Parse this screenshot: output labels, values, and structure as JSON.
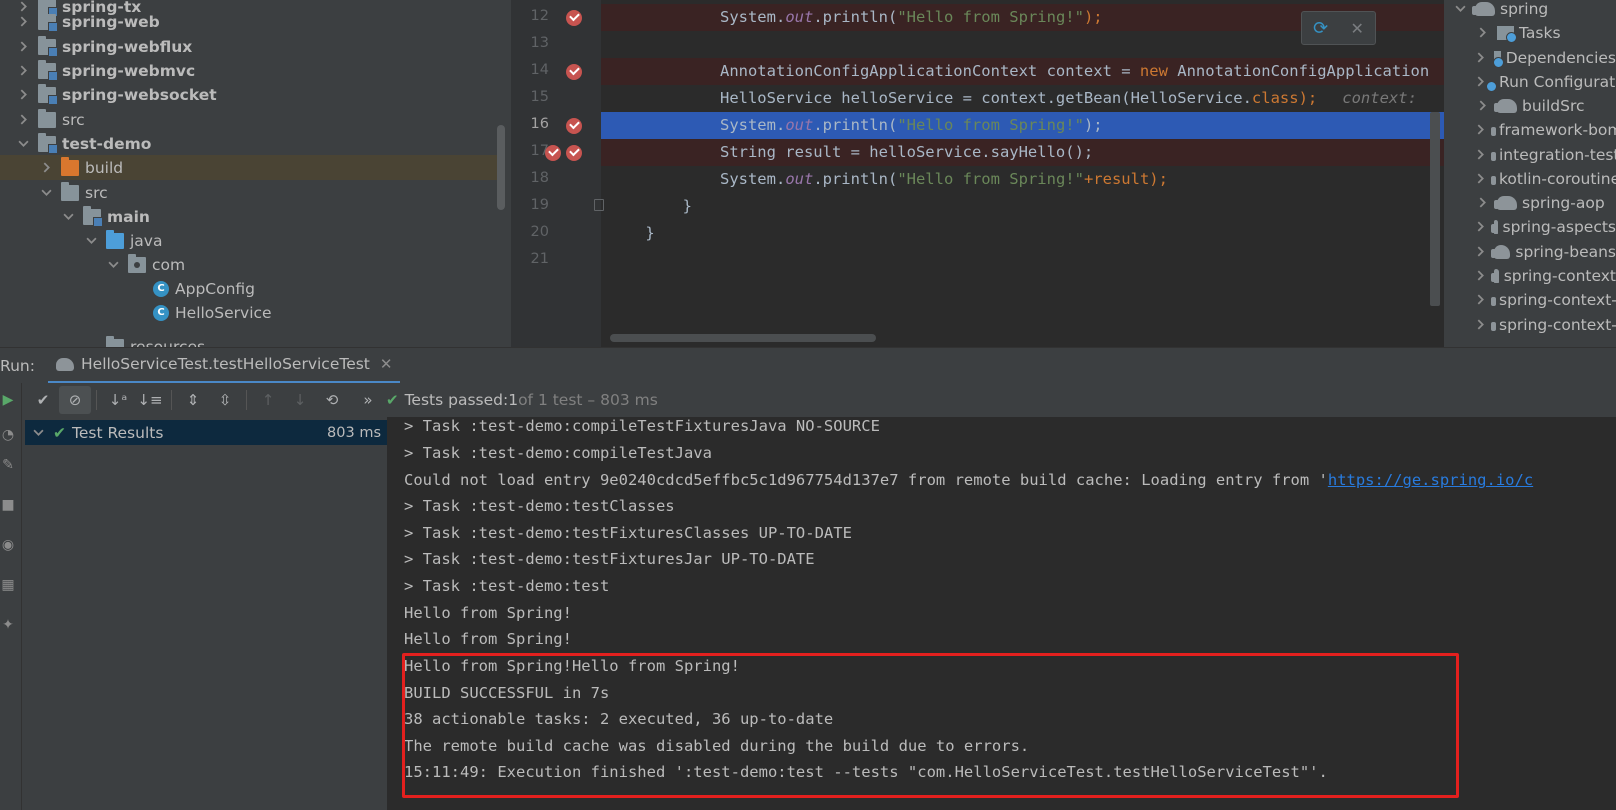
{
  "project_tree": {
    "items": [
      {
        "label": "spring-tx",
        "icon": "module-folder-icon"
      },
      {
        "label": "spring-web",
        "icon": "module-folder-icon"
      },
      {
        "label": "spring-webflux",
        "icon": "module-folder-icon"
      },
      {
        "label": "spring-webmvc",
        "icon": "module-folder-icon"
      },
      {
        "label": "spring-websocket",
        "icon": "module-folder-icon"
      },
      {
        "label": "src",
        "icon": "folder-icon"
      },
      {
        "label": "test-demo",
        "icon": "module-folder-icon"
      },
      {
        "label": "build",
        "icon": "build-folder-icon"
      },
      {
        "label": "src",
        "icon": "folder-icon"
      },
      {
        "label": "main",
        "icon": "source-folder-icon"
      },
      {
        "label": "java",
        "icon": "source-folder-icon"
      },
      {
        "label": "com",
        "icon": "package-icon"
      },
      {
        "label": "AppConfig",
        "icon": "class-icon"
      },
      {
        "label": "HelloService",
        "icon": "class-icon"
      },
      {
        "label": "resources",
        "icon": "folder-icon"
      }
    ]
  },
  "editor": {
    "line_numbers": [
      "12",
      "13",
      "14",
      "15",
      "16",
      "17",
      "18",
      "19",
      "20",
      "21"
    ],
    "current_line": "16",
    "code": {
      "l12": {
        "indent": "            ",
        "a": "System.",
        "b": "out",
        "c": ".println(",
        "d": "\"Hello from Spring!\"",
        "e": ");"
      },
      "l14": {
        "indent": "            ",
        "a": "AnnotationConfigApplicationContext context = ",
        "kw": "new",
        "b": " AnnotationConfigApplication"
      },
      "l15": {
        "indent": "            ",
        "a": "HelloService helloService = context.getBean(HelloService.",
        "kw": "class",
        "b": ");",
        "hint": "context: "
      },
      "l16": {
        "indent": "            ",
        "a": "System.",
        "b": "out",
        "c": ".println(",
        "d": "\"Hello from Spring!\"",
        "e": ");"
      },
      "l17": {
        "indent": "            ",
        "a": "String result = helloService.sayHello();"
      },
      "l18": {
        "indent": "            ",
        "a": "System.",
        "b": "out",
        "c": ".println(",
        "d": "\"Hello from Spring!\"",
        "e": "+result);"
      },
      "l19": {
        "indent": "        ",
        "a": "}"
      },
      "l20": {
        "indent": "    ",
        "a": "}"
      }
    }
  },
  "gradle_panel": {
    "root": "spring",
    "items": [
      {
        "label": "Tasks",
        "icon": "tasks-folder-icon"
      },
      {
        "label": "Dependencies",
        "icon": "dependencies-icon"
      },
      {
        "label": "Run Configurations",
        "icon": "run-config-icon"
      },
      {
        "label": "buildSrc",
        "icon": "gradle-icon"
      },
      {
        "label": "framework-bom",
        "icon": "gradle-icon"
      },
      {
        "label": "integration-tests",
        "icon": "gradle-icon"
      },
      {
        "label": "kotlin-coroutines",
        "icon": "gradle-icon"
      },
      {
        "label": "spring-aop",
        "icon": "gradle-icon"
      },
      {
        "label": "spring-aspects",
        "icon": "gradle-icon"
      },
      {
        "label": "spring-beans",
        "icon": "gradle-icon"
      },
      {
        "label": "spring-context",
        "icon": "gradle-icon"
      },
      {
        "label": "spring-context-indexer",
        "icon": "gradle-icon"
      },
      {
        "label": "spring-context-support",
        "icon": "gradle-icon"
      }
    ]
  },
  "run_window": {
    "label": "Run:",
    "tab_title": "HelloServiceTest.testHelloServiceTest",
    "status": {
      "prefix": "Tests passed: ",
      "count": "1",
      "suffix": " of 1 test – 803 ms"
    },
    "results_root": {
      "label": "Test Results",
      "duration": "803 ms"
    },
    "console_lines": [
      "> Task :test-demo:compileTestFixturesJava NO-SOURCE",
      "> Task :test-demo:compileTestJava",
      "Could not load entry 9e0240cdcd5effbc5c1d967754d137e7 from remote build cache: Loading entry from '",
      "> Task :test-demo:testClasses",
      "> Task :test-demo:testFixturesClasses UP-TO-DATE",
      "> Task :test-demo:testFixturesJar UP-TO-DATE",
      "> Task :test-demo:test",
      "Hello from Spring!",
      "Hello from Spring!",
      "Hello from Spring!Hello from Spring!",
      "BUILD SUCCESSFUL in 7s",
      "38 actionable tasks: 2 executed, 36 up-to-date",
      "The remote build cache was disabled during the build due to errors.",
      "15:11:49: Execution finished ':test-demo:test --tests \"com.HelloServiceTest.testHelloServiceTest\"'."
    ],
    "console_link": "https://ge.spring.io/c"
  },
  "colors": {
    "highlight_box": "#e3201e",
    "execution_line": "#2d5ab4",
    "breakpoint": "#c75450",
    "test_passed": "#59a869"
  }
}
